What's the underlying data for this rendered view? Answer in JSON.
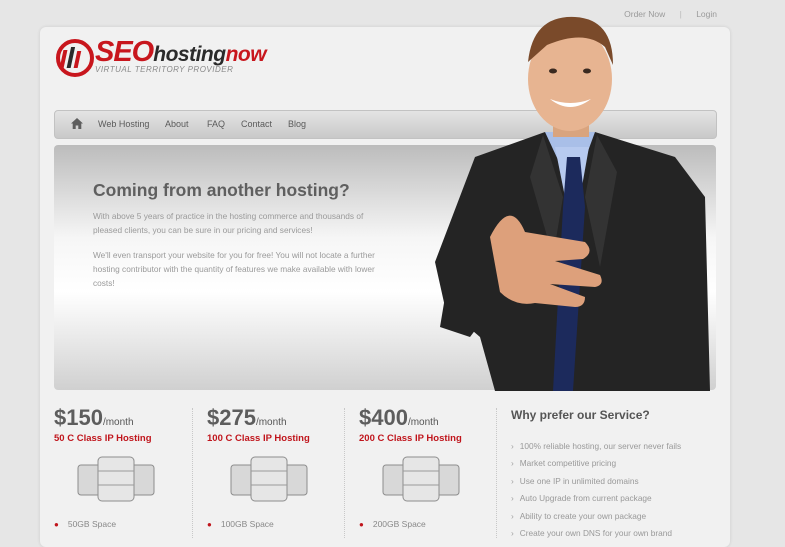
{
  "topbar": {
    "order_now": "Order Now",
    "separator": "|",
    "login": "Login"
  },
  "logo": {
    "seo": "SEO",
    "hosting": "hosting",
    "now": "now",
    "tagline": "VIRTUAL TERRITORY PROVIDER"
  },
  "nav": {
    "home_icon": "home-icon",
    "items": [
      "Web Hosting",
      "About",
      "FAQ",
      "Contact",
      "Blog"
    ]
  },
  "hero": {
    "title": "Coming from another hosting?",
    "para1": "With above 5 years of practice in the hosting commerce and thousands of pleased clients, you can be sure in our pricing and services!",
    "para2": "We'll even transport your website for you for free! You will not locate a further hosting contributor with the quantity of features we make available with lower costs!"
  },
  "plans": [
    {
      "price": "$150",
      "period": "/month",
      "subtitle": "50 C Class IP Hosting",
      "feature": "50GB Space"
    },
    {
      "price": "$275",
      "period": "/month",
      "subtitle": "100 C Class IP Hosting",
      "feature": "100GB Space"
    },
    {
      "price": "$400",
      "period": "/month",
      "subtitle": "200 C Class IP Hosting",
      "feature": "200GB Space"
    }
  ],
  "why": {
    "title": "Why prefer our Service?",
    "items": [
      "100% reliable hosting, our server never fails",
      "Market competitive pricing",
      "Use one IP in unlimited domains",
      "Auto Upgrade from current package",
      "Ability to create your own package",
      "Create your own DNS for your own brand"
    ]
  },
  "colors": {
    "brand_red": "#c8161d",
    "text_gray": "#5f5f5f",
    "nav_bg": "#d4d4d4"
  }
}
